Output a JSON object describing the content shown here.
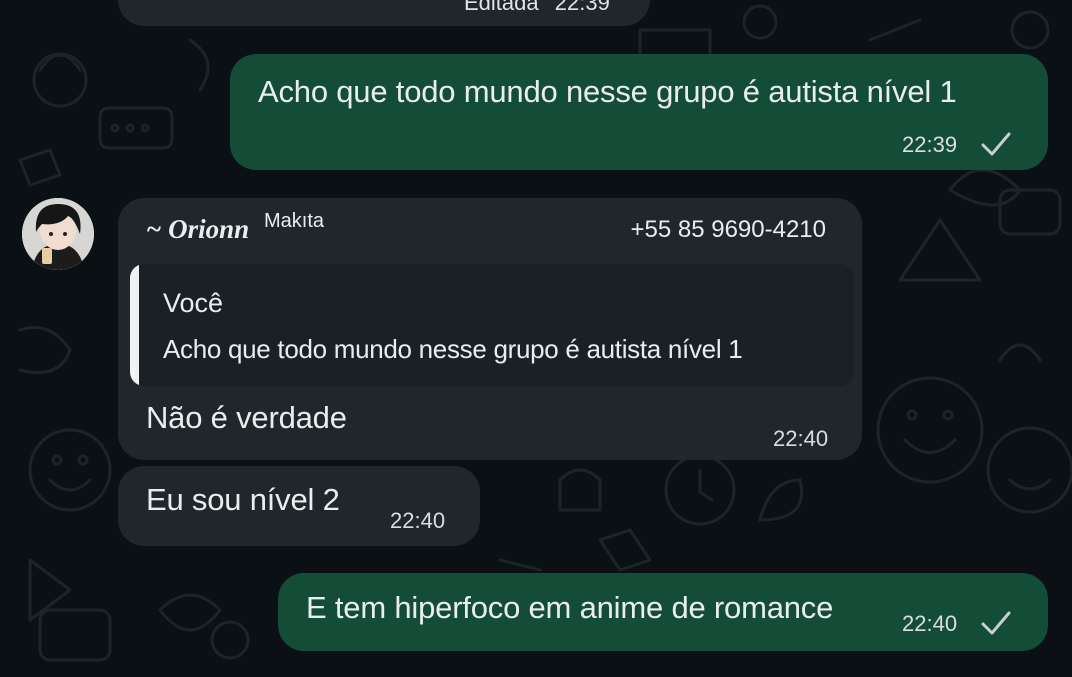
{
  "chat": {
    "previous_message": {
      "edited_label": "Editada",
      "time": "22:39"
    },
    "messages": [
      {
        "direction": "outgoing",
        "text": "Acho que todo mundo nesse grupo é autista nível 1",
        "time": "22:39",
        "status_icon": "check-icon"
      },
      {
        "direction": "incoming",
        "sender_name": "~ Orionn",
        "sender_pushname": "Makıta",
        "sender_phone": "+55 85 9690-4210",
        "quote": {
          "author": "Você",
          "text": "Acho que todo mundo nesse grupo é autista nível 1"
        },
        "text": "Não é verdade",
        "time": "22:40"
      },
      {
        "direction": "incoming",
        "text": "Eu sou nível 2",
        "time": "22:40"
      },
      {
        "direction": "outgoing",
        "text": "E tem hiperfoco em anime de romance",
        "time": "22:40",
        "status_icon": "check-icon"
      }
    ]
  },
  "colors": {
    "background": "#0b1014",
    "outgoing_bubble": "#144d37",
    "incoming_bubble": "#1f272a",
    "quote_background": "#1a2124",
    "text": "#e9edef"
  }
}
